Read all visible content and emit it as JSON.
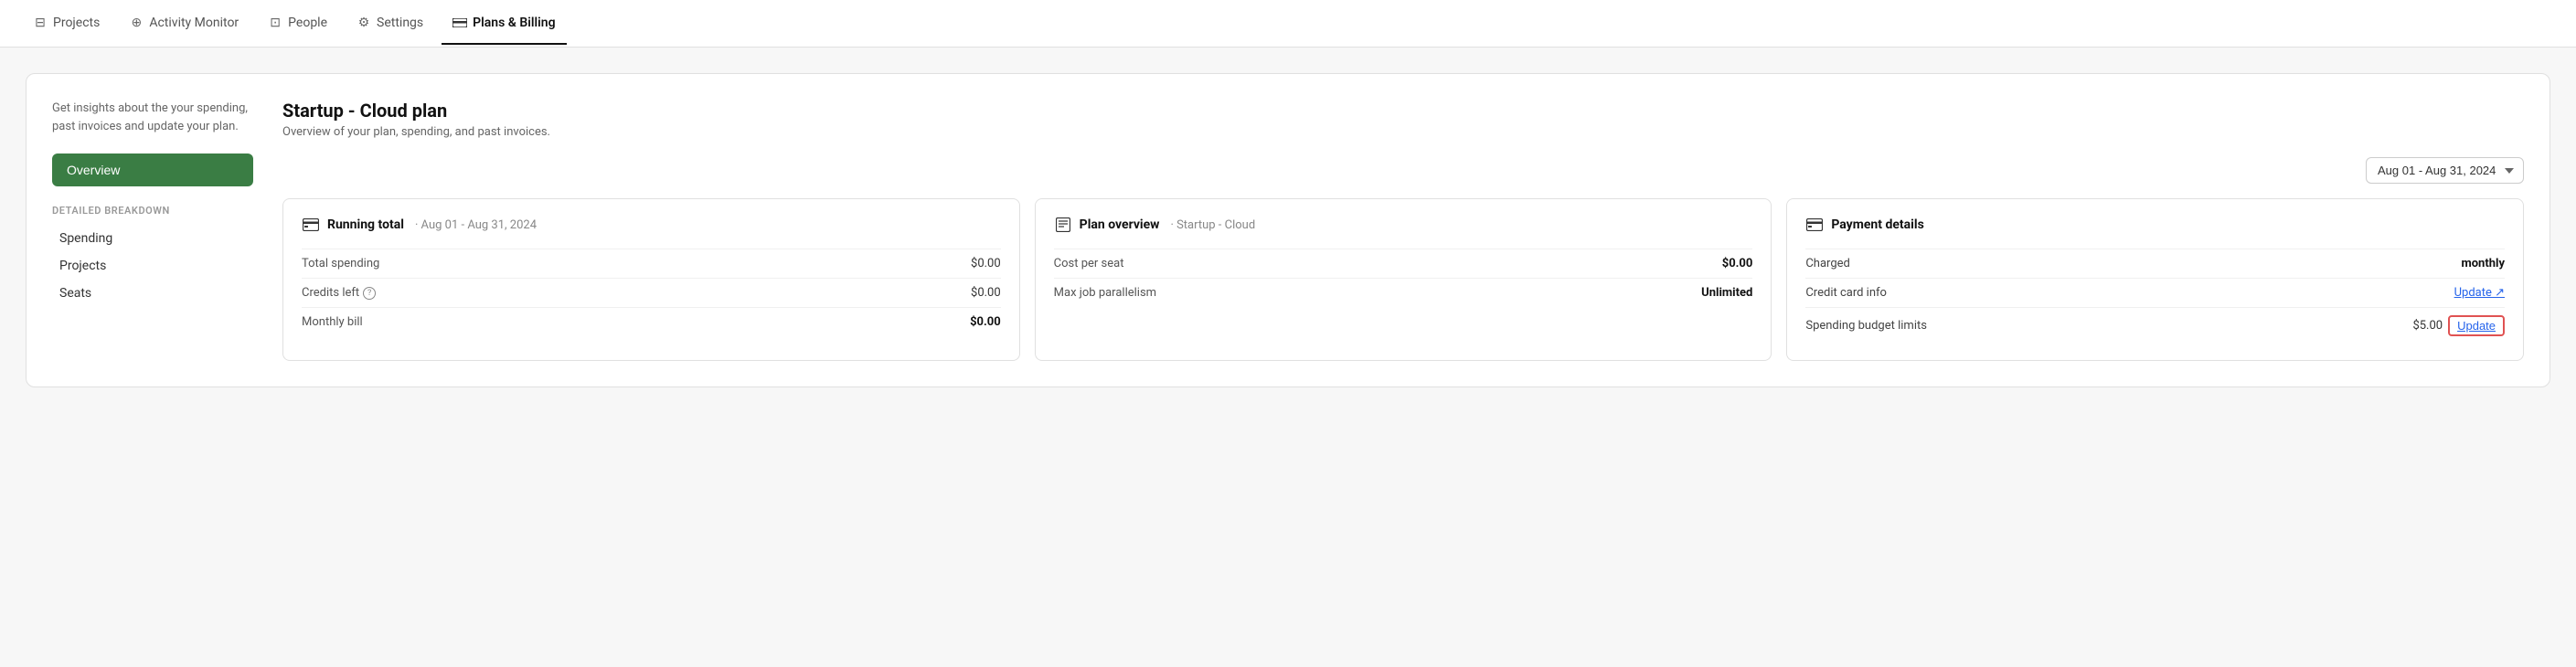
{
  "nav": {
    "items": [
      {
        "id": "projects",
        "label": "Projects",
        "icon": "⊟",
        "active": false
      },
      {
        "id": "activity-monitor",
        "label": "Activity Monitor",
        "icon": "⊕",
        "active": false
      },
      {
        "id": "people",
        "label": "People",
        "icon": "⊡",
        "active": false
      },
      {
        "id": "settings",
        "label": "Settings",
        "icon": "⚙",
        "active": false
      },
      {
        "id": "plans-billing",
        "label": "Plans & Billing",
        "icon": "▬",
        "active": true
      }
    ]
  },
  "sidebar": {
    "description": "Get insights about the your spending, past invoices and update your plan.",
    "overview_label": "Overview",
    "section_label": "DETAILED BREAKDOWN",
    "links": [
      "Spending",
      "Projects",
      "Seats"
    ]
  },
  "main": {
    "plan_title": "Startup - Cloud plan",
    "plan_subtitle": "Overview of your plan, spending, and past invoices.",
    "date_range": "Aug 01 - Aug 31, 2024",
    "cards": {
      "running_total": {
        "icon": "💳",
        "title": "Running total",
        "subtitle": "Aug 01 - Aug 31, 2024",
        "rows": [
          {
            "label": "Total spending",
            "value": "$0.00",
            "bold": false
          },
          {
            "label": "Credits left",
            "value": "$0.00",
            "bold": false,
            "has_info": true
          },
          {
            "label": "Monthly bill",
            "value": "$0.00",
            "bold": true
          }
        ]
      },
      "plan_overview": {
        "icon": "📋",
        "title": "Plan overview",
        "subtitle": "Startup - Cloud",
        "rows": [
          {
            "label": "Cost per seat",
            "value": "$0.00",
            "bold": true
          },
          {
            "label": "Max job parallelism",
            "value": "Unlimited",
            "bold": true
          }
        ]
      },
      "payment_details": {
        "icon": "💳",
        "title": "Payment details",
        "rows": [
          {
            "label": "Charged",
            "value": "monthly",
            "bold": true,
            "type": "text"
          },
          {
            "label": "Credit card info",
            "value": "Update ↗",
            "type": "link"
          },
          {
            "label": "Spending budget limits",
            "value_prefix": "$5.00",
            "value": "Update",
            "type": "outlined-btn"
          }
        ]
      }
    }
  }
}
